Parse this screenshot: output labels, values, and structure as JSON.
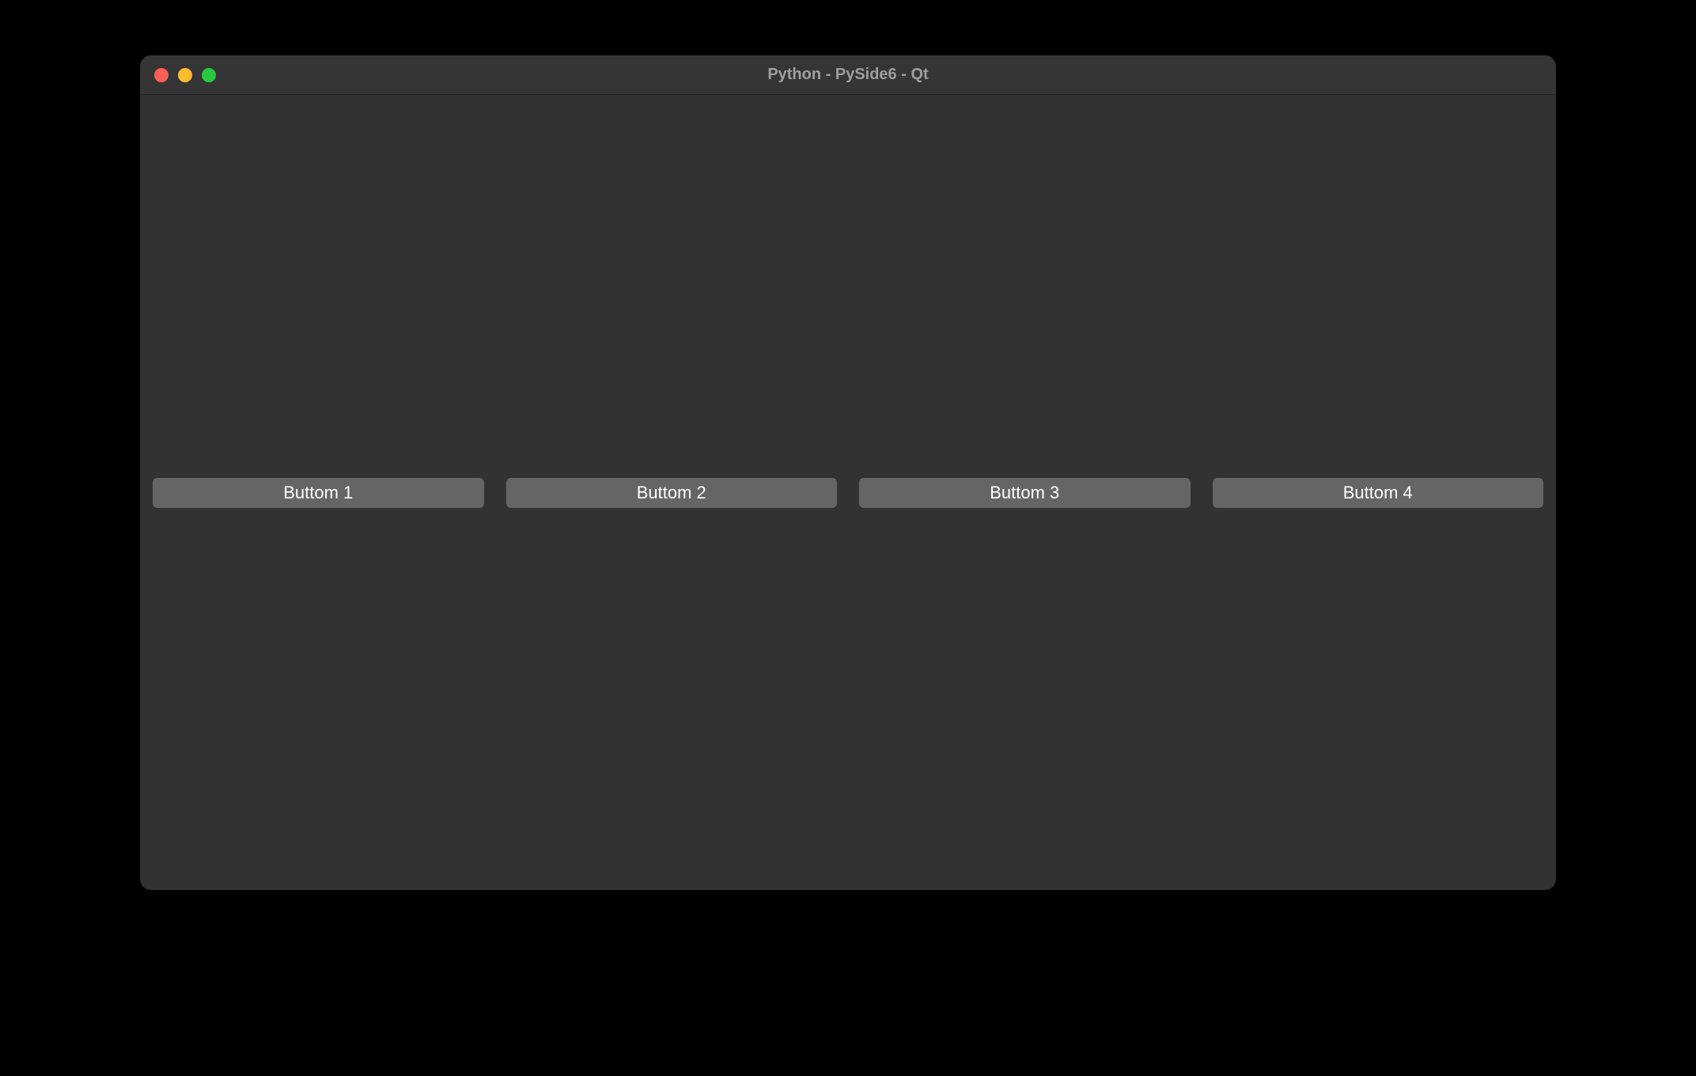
{
  "window": {
    "title": "Python - PySide6 - Qt"
  },
  "buttons": [
    {
      "label": "Buttom 1"
    },
    {
      "label": "Buttom 2"
    },
    {
      "label": "Buttom 3"
    },
    {
      "label": "Buttom 4"
    }
  ]
}
